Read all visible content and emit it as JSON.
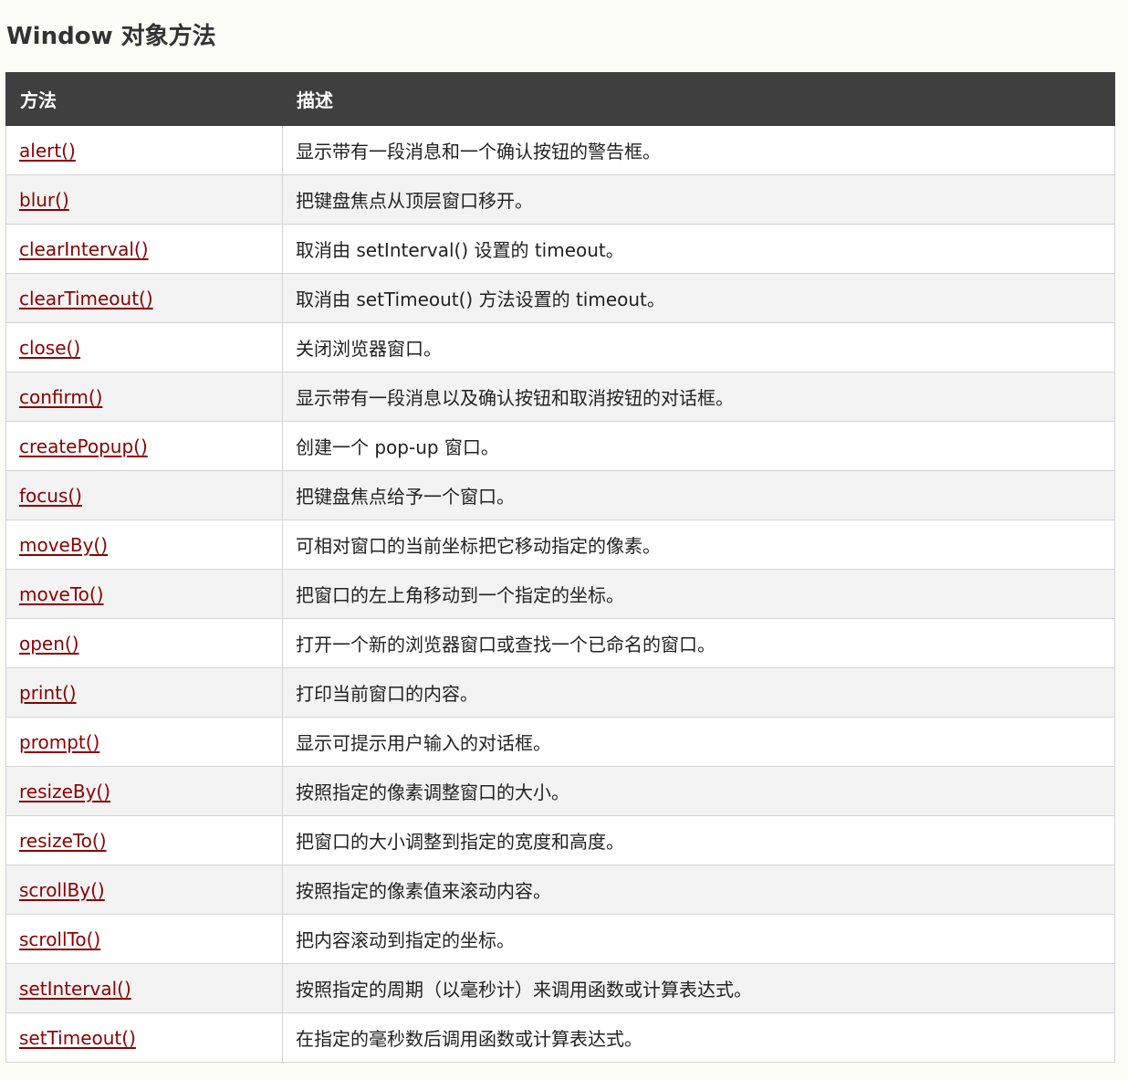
{
  "page": {
    "title": "Window 对象方法"
  },
  "table": {
    "headers": [
      "方法",
      "描述"
    ],
    "rows": [
      {
        "method": "alert()",
        "description": "显示带有一段消息和一个确认按钮的警告框。"
      },
      {
        "method": "blur()",
        "description": "把键盘焦点从顶层窗口移开。"
      },
      {
        "method": "clearInterval()",
        "description": "取消由 setInterval() 设置的 timeout。"
      },
      {
        "method": "clearTimeout()",
        "description": "取消由 setTimeout() 方法设置的 timeout。"
      },
      {
        "method": "close()",
        "description": "关闭浏览器窗口。"
      },
      {
        "method": "confirm()",
        "description": "显示带有一段消息以及确认按钮和取消按钮的对话框。"
      },
      {
        "method": "createPopup()",
        "description": "创建一个 pop-up 窗口。"
      },
      {
        "method": "focus()",
        "description": "把键盘焦点给予一个窗口。"
      },
      {
        "method": "moveBy()",
        "description": "可相对窗口的当前坐标把它移动指定的像素。"
      },
      {
        "method": "moveTo()",
        "description": "把窗口的左上角移动到一个指定的坐标。"
      },
      {
        "method": "open()",
        "description": "打开一个新的浏览器窗口或查找一个已命名的窗口。"
      },
      {
        "method": "print()",
        "description": "打印当前窗口的内容。"
      },
      {
        "method": "prompt()",
        "description": "显示可提示用户输入的对话框。"
      },
      {
        "method": "resizeBy()",
        "description": "按照指定的像素调整窗口的大小。"
      },
      {
        "method": "resizeTo()",
        "description": "把窗口的大小调整到指定的宽度和高度。"
      },
      {
        "method": "scrollBy()",
        "description": "按照指定的像素值来滚动内容。"
      },
      {
        "method": "scrollTo()",
        "description": "把内容滚动到指定的坐标。"
      },
      {
        "method": "setInterval()",
        "description": "按照指定的周期（以毫秒计）来调用函数或计算表达式。"
      },
      {
        "method": "setTimeout()",
        "description": "在指定的毫秒数后调用函数或计算表达式。"
      }
    ]
  },
  "colors": {
    "header_bg": "#3f3f3f",
    "link": "#8b0000",
    "row_alt": "#f3f3f3"
  }
}
